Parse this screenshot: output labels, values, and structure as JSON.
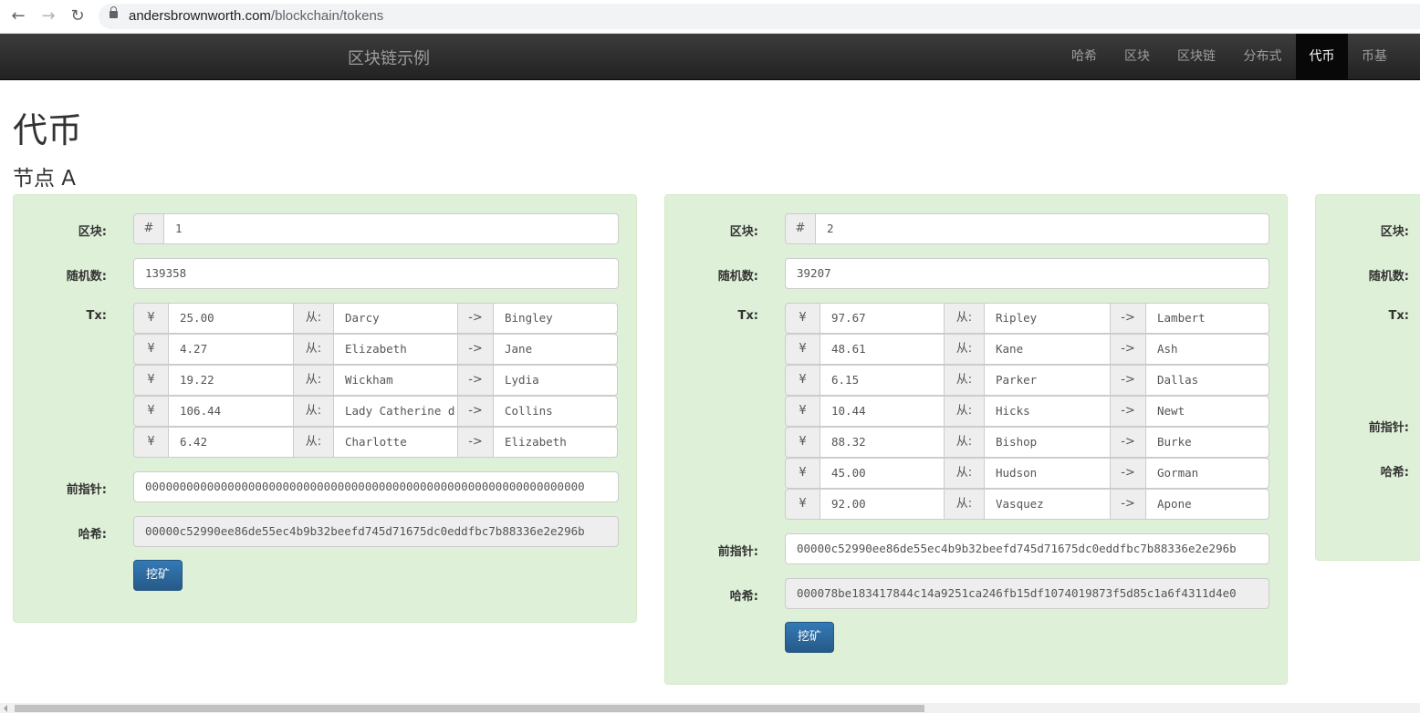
{
  "browser": {
    "url_host": "andersbrownworth.com",
    "url_path": "/blockchain/tokens",
    "back_icon": "back-arrow-icon",
    "forward_icon": "forward-arrow-icon",
    "reload_icon": "reload-icon"
  },
  "navbar": {
    "brand": "区块链示例",
    "items": [
      "哈希",
      "区块",
      "区块链",
      "分布式",
      "代币",
      "币基"
    ],
    "active_index": 4
  },
  "page": {
    "title": "代币",
    "peer": "节点 A"
  },
  "labels": {
    "block": "区块:",
    "nonce": "随机数:",
    "tx": "Tx:",
    "prev": "前指针:",
    "hash": "哈希:",
    "hash_sign": "#",
    "currency": "¥",
    "from": "从:",
    "arrow": "->",
    "mine": "挖矿"
  },
  "blocks": [
    {
      "number": "1",
      "nonce": "139358",
      "tx": [
        {
          "amount": "25.00",
          "from": "Darcy",
          "to": "Bingley"
        },
        {
          "amount": "4.27",
          "from": "Elizabeth",
          "to": "Jane"
        },
        {
          "amount": "19.22",
          "from": "Wickham",
          "to": "Lydia"
        },
        {
          "amount": "106.44",
          "from": "Lady Catherine d",
          "to": "Collins"
        },
        {
          "amount": "6.42",
          "from": "Charlotte",
          "to": "Elizabeth"
        }
      ],
      "prev": "0000000000000000000000000000000000000000000000000000000000000000",
      "hash": "00000c52990ee86de55ec4b9b32beefd745d71675dc0eddfbc7b88336e2e296b"
    },
    {
      "number": "2",
      "nonce": "39207",
      "tx": [
        {
          "amount": "97.67",
          "from": "Ripley",
          "to": "Lambert"
        },
        {
          "amount": "48.61",
          "from": "Kane",
          "to": "Ash"
        },
        {
          "amount": "6.15",
          "from": "Parker",
          "to": "Dallas"
        },
        {
          "amount": "10.44",
          "from": "Hicks",
          "to": "Newt"
        },
        {
          "amount": "88.32",
          "from": "Bishop",
          "to": "Burke"
        },
        {
          "amount": "45.00",
          "from": "Hudson",
          "to": "Gorman"
        },
        {
          "amount": "92.00",
          "from": "Vasquez",
          "to": "Apone"
        }
      ],
      "prev": "00000c52990ee86de55ec4b9b32beefd745d71675dc0eddfbc7b88336e2e296b",
      "hash": "000078be183417844c14a9251ca246fb15df1074019873f5d85c1a6f4311d4e0"
    }
  ],
  "colors": {
    "well_bg": "#dff0d8",
    "navbar_bg": "#222222",
    "button_bg": "#337ab7"
  }
}
